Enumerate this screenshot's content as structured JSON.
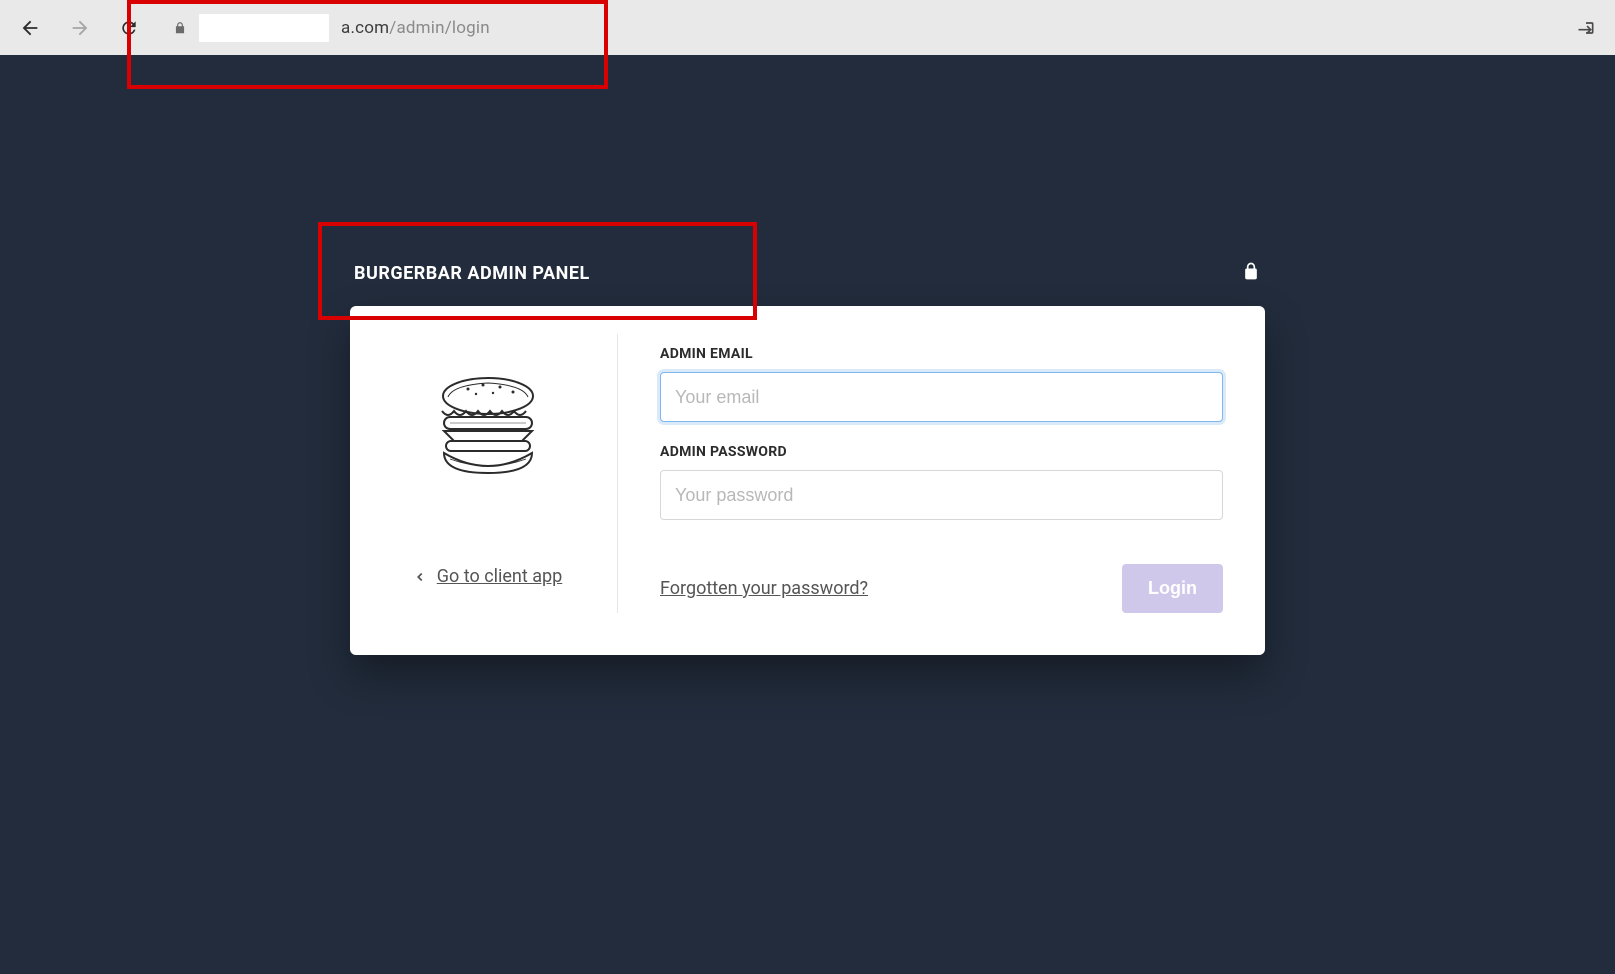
{
  "browser": {
    "url_visible_prefix": "a.com",
    "url_path": "/admin/login"
  },
  "header": {
    "title": "BURGERBAR ADMIN PANEL"
  },
  "left": {
    "back_link_label": "Go to client app"
  },
  "form": {
    "email_label": "ADMIN EMAIL",
    "email_placeholder": "Your email",
    "email_value": "",
    "password_label": "ADMIN PASSWORD",
    "password_placeholder": "Your password",
    "password_value": "",
    "forgot_label": "Forgotten your password?",
    "login_button_label": "Login"
  }
}
